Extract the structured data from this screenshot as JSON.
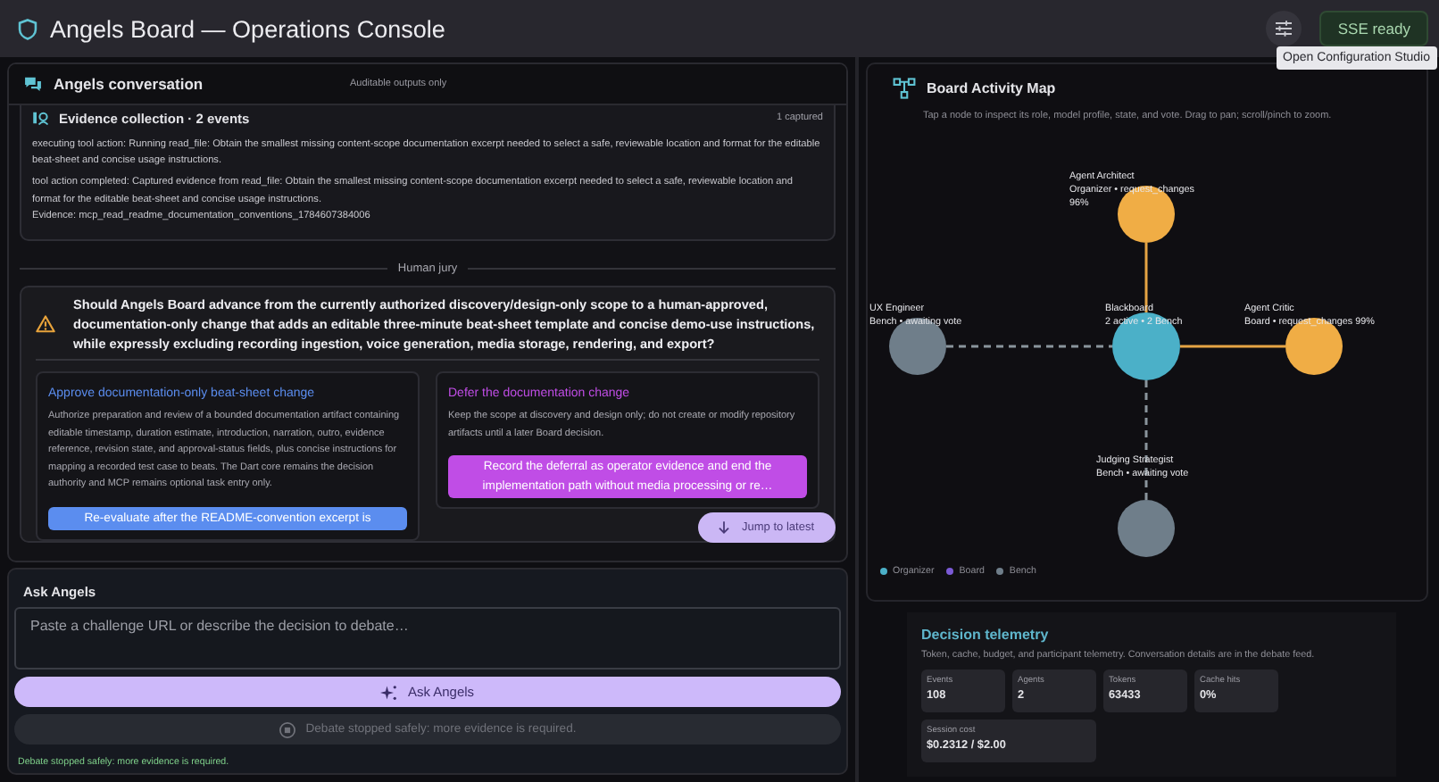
{
  "header": {
    "title": "Angels Board — Operations Console",
    "status": "SSE ready",
    "tooltip": "Open Configuration Studio"
  },
  "conversation": {
    "title": "Angels conversation",
    "note": "Auditable outputs only",
    "evidence": {
      "title": "Evidence collection · 2 events",
      "count": "1 captured",
      "entries": [
        {
          "text": "executing tool action: Running read_file: Obtain the smallest missing content-scope documentation excerpt needed to select a safe, reviewable location and format for the editable beat-sheet and concise usage instructions."
        },
        {
          "text": "tool action completed: Captured evidence from read_file: Obtain the smallest missing content-scope documentation excerpt needed to select a safe, reviewable location and format for the editable beat-sheet and concise usage instructions.",
          "evidence": "Evidence: mcp_read_readme_documentation_conventions_1784607384006"
        }
      ]
    },
    "divider": "Human jury",
    "question": "Should Angels Board advance from the currently authorized discovery/design-only scope to a human-approved, documentation-only change that adds an editable three-minute beat-sheet template and concise demo-use instructions, while expressly excluding recording ingestion, voice generation, media storage, rendering, and export?",
    "options": [
      {
        "title": "Approve documentation-only beat-sheet change",
        "color": "#5b8def",
        "text": "Authorize preparation and review of a bounded documentation artifact containing editable timestamp, duration estimate, introduction, narration, outro, evidence reference, revision state, and approval-status fields, plus concise instructions for mapping a recorded test case to beats. The Dart core remains the decision authority and MCP remains optional task entry only.",
        "action": "Re-evaluate after the README-convention excerpt is"
      },
      {
        "title": "Defer the documentation change",
        "color": "#c04de6",
        "text": "Keep the scope at discovery and design only; do not create or modify repository artifacts until a later Board decision.",
        "action": "Record the deferral as operator evidence and end the implementation path without media processing or re…"
      }
    ],
    "jump": "Jump to latest"
  },
  "ask": {
    "title": "Ask Angels",
    "placeholder": "Paste a challenge URL or describe the decision to debate…",
    "button": "Ask Angels",
    "stop": {
      "label": "Debate stopped safely: more evidence is required.",
      "disabled": true
    },
    "status": "Debate stopped safely: more evidence is required."
  },
  "map": {
    "title": "Board Activity Map",
    "hint": "Tap a node to inspect its role, model profile, state, and vote. Drag to pan; scroll/pinch to zoom.",
    "nodes": [
      {
        "name": "Agent Architect",
        "details": [
          "Organizer • request_changes",
          "96%"
        ],
        "color": "#f0ad45",
        "active": true
      },
      {
        "name": "UX Engineer",
        "details": [
          "Bench • awaiting vote"
        ],
        "color": "#6f7e8a",
        "active": false
      },
      {
        "name": "Blackboard",
        "details": [
          "2 active • 2 Bench"
        ],
        "color": "#4bb0c8",
        "kind": "hub"
      },
      {
        "name": "Agent Critic",
        "details": [
          "Board • request_changes 99%"
        ],
        "color": "#f0ad45",
        "active": true
      },
      {
        "name": "Judging Strategist",
        "details": [
          "Bench • awaiting vote"
        ],
        "color": "#6f7e8a",
        "active": false
      }
    ],
    "legend": [
      {
        "label": "Organizer",
        "color": "#4bb0c8"
      },
      {
        "label": "Board",
        "color": "#7b5ad6"
      },
      {
        "label": "Bench",
        "color": "#6f7e8a"
      }
    ]
  },
  "telemetry": {
    "title": "Decision telemetry",
    "description": "Token, cache, budget, and participant telemetry. Conversation details are in the debate feed.",
    "stats": [
      {
        "label": "Events",
        "value": "108"
      },
      {
        "label": "Agents",
        "value": "2"
      },
      {
        "label": "Tokens",
        "value": "63433"
      },
      {
        "label": "Cache hits",
        "value": "0%"
      },
      {
        "label": "Session cost",
        "value": "$0.2312 / $2.00",
        "kind": "wide"
      }
    ]
  }
}
